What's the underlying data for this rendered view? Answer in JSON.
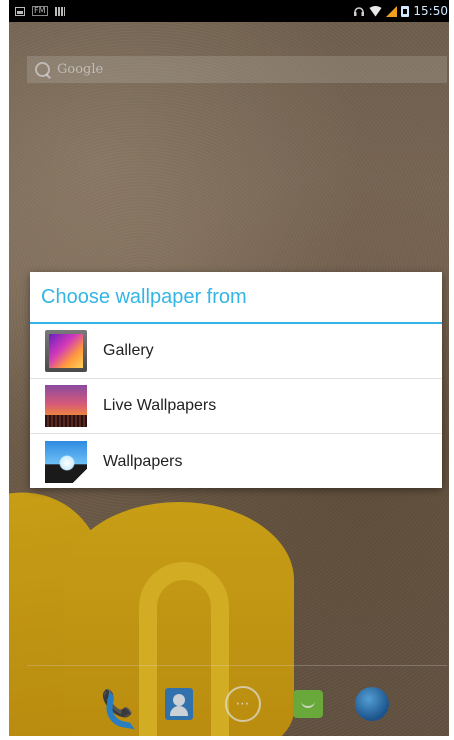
{
  "status_bar": {
    "fm_label": "FM",
    "time": "15:50",
    "icons": [
      "screenshot-icon",
      "fm-radio-icon",
      "bars-icon",
      "headset-icon",
      "wifi-icon",
      "signal-icon",
      "sim-icon"
    ]
  },
  "home": {
    "search_placeholder": "Google",
    "dock": [
      "phone-icon",
      "contacts-icon",
      "apps-icon",
      "messaging-icon",
      "browser-icon"
    ],
    "apps_glyph": "⋯"
  },
  "dialog": {
    "title": "Choose wallpaper from",
    "items": [
      {
        "label": "Gallery",
        "icon": "gallery-icon"
      },
      {
        "label": "Live Wallpapers",
        "icon": "live-wallpapers-icon"
      },
      {
        "label": "Wallpapers",
        "icon": "wallpapers-icon"
      }
    ]
  },
  "colors": {
    "accent": "#33b5e5",
    "dialog_bg": "#ffffff",
    "status_bar_bg": "#000000"
  }
}
